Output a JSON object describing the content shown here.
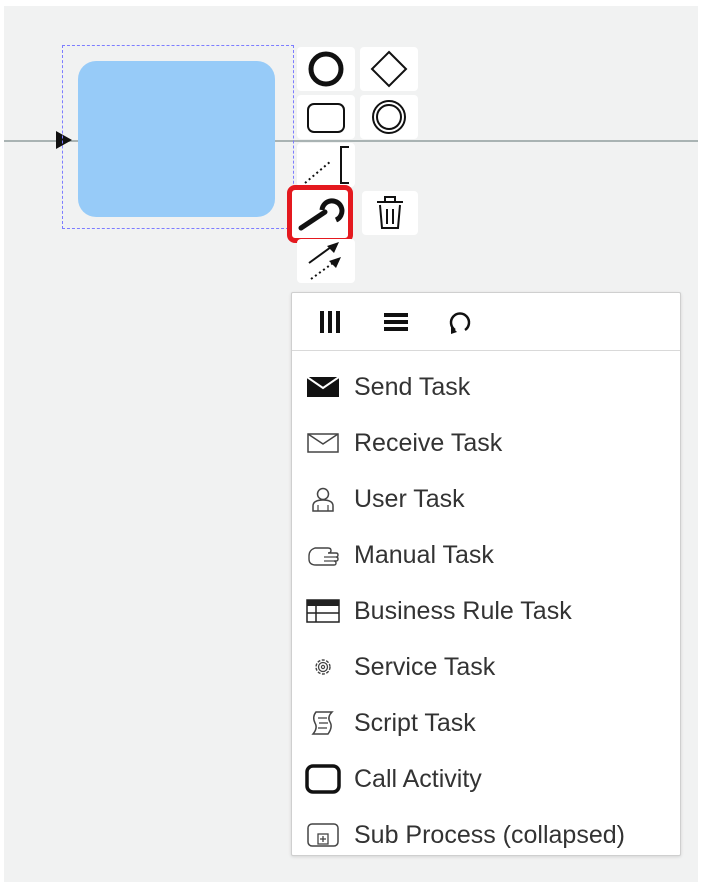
{
  "popup": {
    "header_icons": [
      "parallel-multi-instance-icon",
      "sequential-multi-instance-icon",
      "loop-icon"
    ],
    "entries": [
      {
        "label": "Send Task",
        "icon": "envelope-filled-icon"
      },
      {
        "label": "Receive Task",
        "icon": "envelope-outline-icon"
      },
      {
        "label": "User Task",
        "icon": "user-icon"
      },
      {
        "label": "Manual Task",
        "icon": "hand-icon"
      },
      {
        "label": "Business Rule Task",
        "icon": "table-icon"
      },
      {
        "label": "Service Task",
        "icon": "gear-icon"
      },
      {
        "label": "Script Task",
        "icon": "script-icon"
      },
      {
        "label": "Call Activity",
        "icon": "bold-rounded-rect-icon"
      },
      {
        "label": "Sub Process (collapsed)",
        "icon": "collapsed-subprocess-icon"
      }
    ]
  },
  "context_pad": {
    "tools": [
      "append-end-event",
      "append-gateway",
      "append-task",
      "append-intermediate-event",
      "append-text-annotation",
      "change-type",
      "delete",
      "connect"
    ],
    "highlighted_tool": "change-type"
  },
  "colors": {
    "canvas": "#f1f2f2",
    "task_fill": "#97cbf8",
    "selection": "#7d7dff",
    "highlight": "#e4191f",
    "flow_line": "#a9b3b3"
  }
}
